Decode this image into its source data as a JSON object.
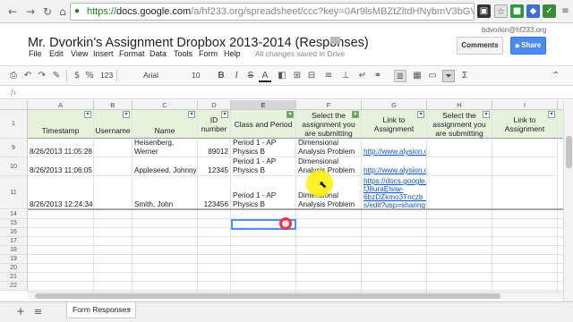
{
  "browser": {
    "url_scheme": "https://",
    "url_host": "docs.google.com",
    "url_path": "/a/hf233.org/spreadsheet/ccc?key=0Ar9lsMBZtZltdHNybmV3bGVrZnZpcjBHNll"
  },
  "doc": {
    "title": "Mr. Dvorkin's Assignment Dropbox 2013-2014 (Responses)",
    "account": "bdvorkin@hf233.org",
    "comments_label": "Comments",
    "share_label": "Share"
  },
  "menu": [
    "File",
    "Edit",
    "View",
    "Insert",
    "Format",
    "Data",
    "Tools",
    "Form",
    "Help"
  ],
  "saved_status": "All changes saved in Drive",
  "toolbar": {
    "number_format": "123",
    "font": "Arial",
    "font_size": "10",
    "bold": "B",
    "italic": "I",
    "strike": "S",
    "text_color": "A"
  },
  "formula_bar": {
    "label": "fx"
  },
  "columns": [
    "A",
    "B",
    "C",
    "D",
    "E",
    "F",
    "G",
    "H",
    "I",
    "J"
  ],
  "header_row": {
    "row_number": "1",
    "cells": [
      "Timestamp",
      "Username",
      "Name",
      "ID number",
      "Class and Period",
      "Select the assignment you are submitting",
      "Link to Assignment",
      "Select the assignment you are submitting",
      "Link to Assignment",
      ""
    ]
  },
  "rows": [
    {
      "num": "9",
      "timestamp": "8/26/2013 11:05:28",
      "username": "",
      "name": "Heisenberg, Werner",
      "id": "89012",
      "class": "Period 1 - AP Physics B",
      "assignment": "Dimensional Analysis Problem",
      "link": "http://www.alysion.o"
    },
    {
      "num": "10",
      "timestamp": "8/26/2013 11:06:05",
      "username": "",
      "name": "Appleseed, Johnny",
      "id": "12345",
      "class": "Period 1 - AP Physics B",
      "assignment": "Dimensional Analysis Problem",
      "link": "http://www.alysion.o"
    },
    {
      "num": "11",
      "timestamp": "8/26/2013 12:24:34",
      "username": "",
      "name": "Smith, John",
      "id": "123456",
      "class": "Period 1 - AP Physics B",
      "assignment": "Dimensional Analysis Problem",
      "link_lines": [
        "https://docs.google.c",
        "fJ8uraElsiw-",
        "6bzDZkmo3Tnczb_S",
        "s/edit?usp=sharing"
      ]
    }
  ],
  "empty_rows": [
    "14",
    "15",
    "16",
    "17",
    "18",
    "19",
    "20",
    "21",
    "22"
  ],
  "sheet_tabs": [
    "Form Responses"
  ]
}
